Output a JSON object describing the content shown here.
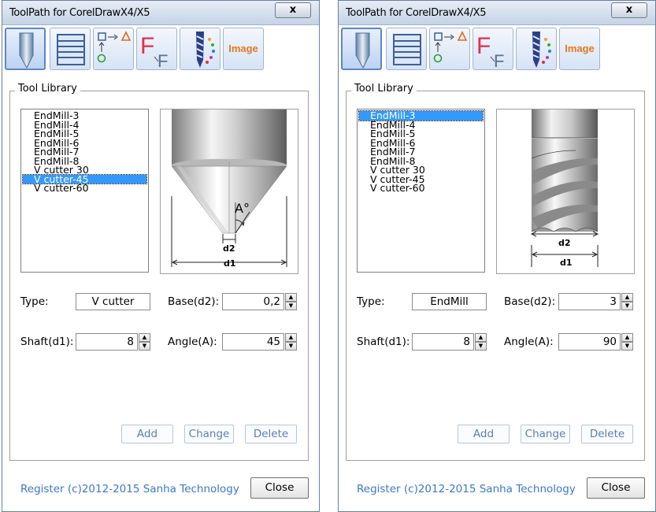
{
  "windows": [
    {
      "title": "ToolPath for CorelDrawX4/X5",
      "close_glyph": "x",
      "toolbar": {
        "buttons": [
          {
            "name": "tool-bit-button",
            "icon": "tool-bit-icon",
            "active": true
          },
          {
            "name": "layers-button",
            "icon": "horizontal-lines-icon"
          },
          {
            "name": "path-order-button",
            "icon": "node-sequence-icon"
          },
          {
            "name": "font-button",
            "icon": "font-f-icon"
          },
          {
            "name": "drill-button",
            "icon": "drill-icon"
          },
          {
            "name": "image-button",
            "icon": "image-icon",
            "label": "Image"
          }
        ]
      },
      "group_label": "Tool Library",
      "list": {
        "items": [
          "EndMill-3",
          "EndMill-4",
          "EndMill-5",
          "EndMill-6",
          "EndMill-7",
          "EndMill-8",
          "V cutter 30",
          "V cutter-45",
          "V cutter-60"
        ],
        "selected_index": 7
      },
      "preview": {
        "kind": "v-cutter",
        "labels": {
          "d2": "d2",
          "d1": "d1",
          "angle": "A°"
        }
      },
      "form": {
        "type_label": "Type:",
        "type_value": "V cutter",
        "base_label": "Base(d2):",
        "base_value": "0,2",
        "shaft_label": "Shaft(d1):",
        "shaft_value": "8",
        "angle_label": "Angle(A):",
        "angle_value": "45"
      },
      "buttons": {
        "add": "Add",
        "change": "Change",
        "delete": "Delete"
      },
      "footer": {
        "register": "Register",
        "copyright": "(c)2012-2015 Sanha Technology",
        "close": "Close"
      }
    },
    {
      "title": "ToolPath for CorelDrawX4/X5",
      "close_glyph": "x",
      "toolbar": {
        "buttons": [
          {
            "name": "tool-bit-button",
            "icon": "tool-bit-icon",
            "active": true
          },
          {
            "name": "layers-button",
            "icon": "horizontal-lines-icon"
          },
          {
            "name": "path-order-button",
            "icon": "node-sequence-icon"
          },
          {
            "name": "font-button",
            "icon": "font-f-icon"
          },
          {
            "name": "drill-button",
            "icon": "drill-icon"
          },
          {
            "name": "image-button",
            "icon": "image-icon",
            "label": "Image"
          }
        ]
      },
      "group_label": "Tool Library",
      "list": {
        "items": [
          "EndMill-3",
          "EndMill-4",
          "EndMill-5",
          "EndMill-6",
          "EndMill-7",
          "EndMill-8",
          "V cutter 30",
          "V cutter-45",
          "V cutter-60"
        ],
        "selected_index": 0
      },
      "preview": {
        "kind": "end-mill",
        "labels": {
          "d2": "d2",
          "d1": "d1"
        }
      },
      "form": {
        "type_label": "Type:",
        "type_value": "EndMill",
        "base_label": "Base(d2):",
        "base_value": "3",
        "shaft_label": "Shaft(d1):",
        "shaft_value": "8",
        "angle_label": "Angle(A):",
        "angle_value": "90"
      },
      "buttons": {
        "add": "Add",
        "change": "Change",
        "delete": "Delete"
      },
      "footer": {
        "register": "Register",
        "copyright": "(c)2012-2015 Sanha Technology",
        "close": "Close"
      }
    }
  ],
  "colors": {
    "selection": "#3399ff",
    "link": "#3c78c8",
    "image_label": "#e07a1e",
    "button_text": "#5a7fb2"
  }
}
